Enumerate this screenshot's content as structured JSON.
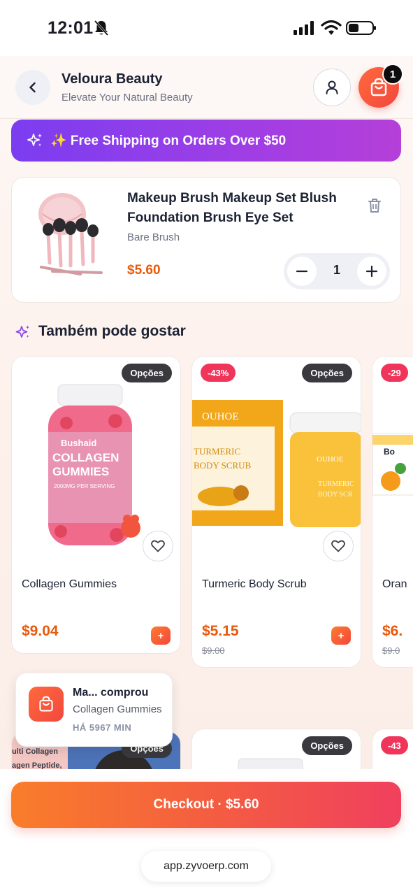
{
  "status_bar": {
    "time": "12:01"
  },
  "header": {
    "title": "Veloura Beauty",
    "subtitle": "Elevate Your Natural Beauty",
    "cart_count": "1"
  },
  "promo": {
    "text": "✨ Free Shipping on Orders Over $50"
  },
  "cart_item": {
    "title": "Makeup Brush Makeup Set Blush Foundation Brush Eye Set",
    "brand": "Bare Brush",
    "price": "$5.60",
    "quantity": "1"
  },
  "recommendations": {
    "title": "Também pode gostar",
    "products": [
      {
        "name": "Collagen Gummies",
        "price": "$9.04",
        "old_price": "",
        "discount": "",
        "options_label": "Opções",
        "add_label": "+"
      },
      {
        "name": "Turmeric Body Scrub",
        "price": "$5.15",
        "old_price": "$9.00",
        "discount": "-43%",
        "options_label": "Opções",
        "add_label": "+"
      },
      {
        "name": "Oran",
        "price": "$6.",
        "old_price": "$9.0",
        "discount": "-29",
        "options_label": "",
        "add_label": ""
      }
    ],
    "row2": [
      {
        "options_label": "Opções",
        "image_text": "ulti Collagen\nagen Peptide,"
      },
      {
        "options_label": "Opções"
      },
      {
        "discount": "-43"
      }
    ]
  },
  "toast": {
    "title": "Ma... comprou",
    "product": "Collagen Gummies",
    "time": "HÁ 5967 MIN"
  },
  "checkout": {
    "label": "Checkout · $5.60"
  },
  "browser": {
    "url": "app.zyvoerp.com"
  },
  "colors": {
    "accent_orange": "#e8590c",
    "promo_purple": "#7b3df0",
    "discount_pink": "#f0345a"
  }
}
